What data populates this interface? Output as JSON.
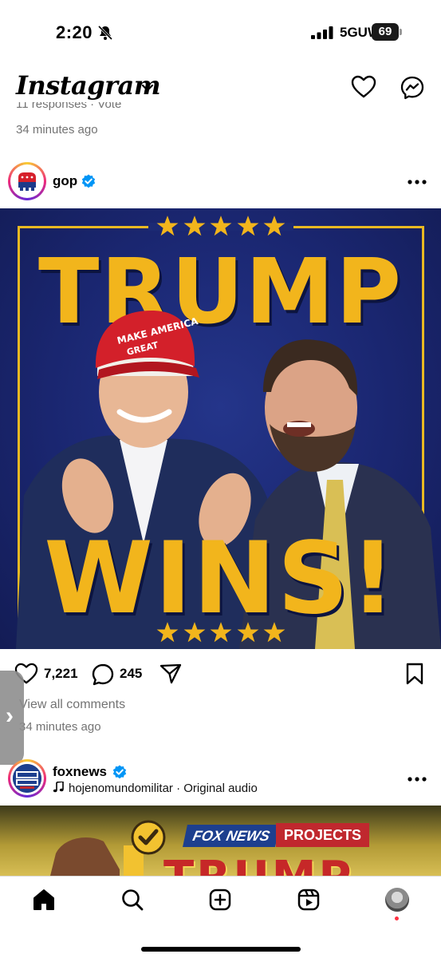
{
  "status_bar": {
    "time": "2:20",
    "network": "5GUW",
    "battery": "69"
  },
  "header": {
    "app_name": "Instagram"
  },
  "prev_post": {
    "cut_text": "11 responses · Vote",
    "time_ago": "34 minutes ago"
  },
  "post": {
    "username": "gop",
    "image_text_top": "TRUMP",
    "image_text_bottom": "WINS!",
    "likes": "7,221",
    "comments": "245",
    "view_comments": "View all comments",
    "time_ago": "34 minutes ago"
  },
  "next_post": {
    "username": "foxnews",
    "audio": "hojenomundomilitar · Original audio",
    "banner_left": "FOX NEWS",
    "banner_right": "PROJECTS",
    "image_word": "TRUMP"
  },
  "colors": {
    "accent_gold": "#f2b51c",
    "navy": "#1a2670",
    "verified_blue": "#0095f6",
    "notification_red": "#ff3040"
  },
  "icons": [
    "bell-slash-icon",
    "signal-icon",
    "chevron-down-icon",
    "heart-icon",
    "messenger-icon",
    "verified-icon",
    "more-icon",
    "comment-icon",
    "share-icon",
    "bookmark-icon",
    "music-note-icon",
    "home-icon",
    "search-icon",
    "create-icon",
    "reels-icon"
  ]
}
